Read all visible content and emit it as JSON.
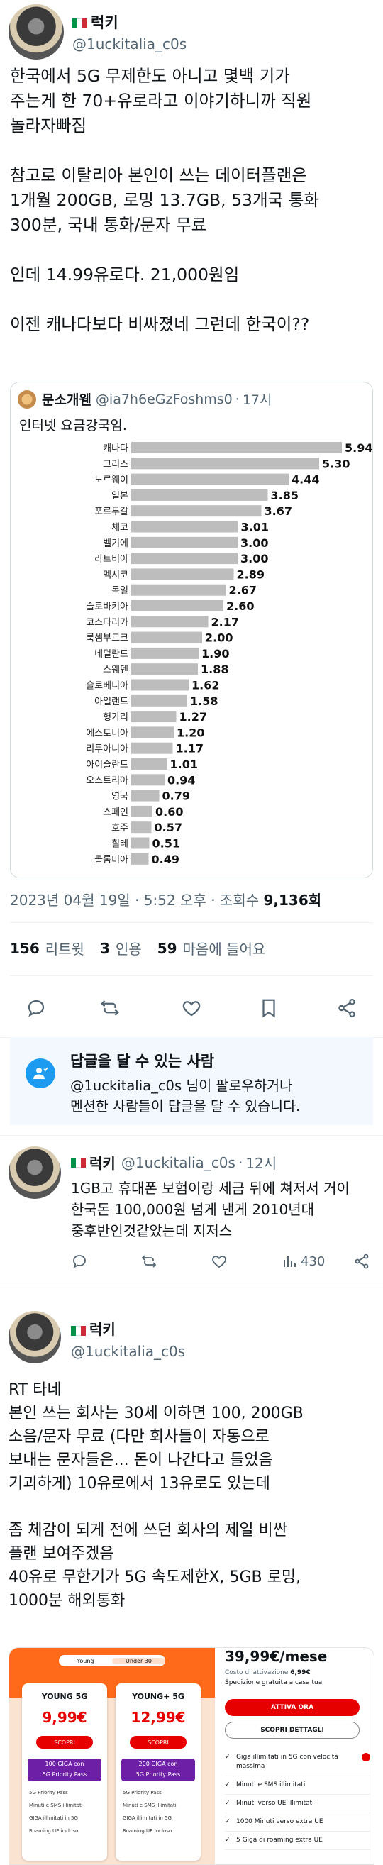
{
  "tweet": {
    "author_name": "럭키",
    "author_handle": "@1uckitalia_c0s",
    "paragraphs": [
      [
        "한국에서 5G 무제한도 아니고 몇백 기가",
        "주는게 한 70+유로라고 이야기하니까 직원",
        "놀라자빠짐"
      ],
      [
        "참고로 이탈리아 본인이 쓰는 데이터플랜은",
        "1개월 200GB, 로밍 13.7GB, 53개국 통화",
        "300분, 국내 통화/문자 무료"
      ],
      [
        "인데 14.99유로다. 21,000원임"
      ],
      [
        "이젠 캐나다보다 비싸졌네 그런데 한국이??"
      ]
    ],
    "quote": {
      "author_name": "문소개웬",
      "author_handle": "@ia7h6eGzFoshms0",
      "time": "17시",
      "text": "인터넷 요금강국임."
    },
    "timestamp": "2023년 04월 19일 · 5:52 오후 · 조회수",
    "views": "9,136회",
    "stats": {
      "retweets_count": "156",
      "retweets_label": "리트윗",
      "quotes_count": "3",
      "quotes_label": "인용",
      "likes_count": "59",
      "likes_label": "마음에 들어요"
    }
  },
  "chart_data": {
    "type": "bar",
    "orientation": "horizontal",
    "categories": [
      "캐나다",
      "그리스",
      "노르웨이",
      "일본",
      "포르투갈",
      "체코",
      "벨기에",
      "라트비아",
      "멕시코",
      "독일",
      "슬로바키아",
      "코스타리카",
      "룩셈부르크",
      "네덜란드",
      "스웨덴",
      "슬로베니아",
      "아일랜드",
      "헝가리",
      "에스토니아",
      "리투아니아",
      "아이슬란드",
      "오스트리아",
      "영국",
      "스페인",
      "호주",
      "칠레",
      "콜롬비아"
    ],
    "values": [
      5.94,
      5.3,
      4.44,
      3.85,
      3.67,
      3.01,
      3.0,
      3.0,
      2.89,
      2.67,
      2.6,
      2.17,
      2.0,
      1.9,
      1.88,
      1.62,
      1.58,
      1.27,
      1.2,
      1.17,
      1.01,
      0.94,
      0.79,
      0.6,
      0.57,
      0.51,
      0.49
    ],
    "value_labels": [
      "5.94",
      "5.30",
      "4.44",
      "3.85",
      "3.67",
      "3.01",
      "3.00",
      "3.00",
      "2.89",
      "2.67",
      "2.60",
      "2.17",
      "2.00",
      "1.90",
      "1.88",
      "1.62",
      "1.58",
      "1.27",
      "1.20",
      "1.17",
      "1.01",
      "0.94",
      "0.79",
      "0.60",
      "0.57",
      "0.51",
      "0.49"
    ],
    "xlim": [
      0,
      6.6
    ],
    "bar_color": "#bdbdbd",
    "grid": false
  },
  "reply_restriction": {
    "title": "답글을 달 수 있는 사람",
    "line1": "@1uckitalia_c0s 님이 팔로우하거나",
    "line2": "멘션한 사람들이 답글을 달 수 있습니다."
  },
  "reply": {
    "author_name": "럭키",
    "author_handle": "@1uckitalia_c0s",
    "time": "12시",
    "lines": [
      "1GB고 휴대폰 보험이랑 세금 뒤에 쳐저서 거이",
      "한국돈 100,000원 넘게 낸게 2010년대",
      "중후반인것같았는데 지저스"
    ],
    "views": "430"
  },
  "thread": {
    "author_name": "럭키",
    "author_handle": "@1uckitalia_c0s",
    "paragraphs": [
      [
        "RT 타네",
        "본인 쓰는 회사는 30세 이하면 100, 200GB",
        "소음/문자 무료 (다만 회사들이 자동으로",
        "보내는 문자들은... 돈이 나간다고 들었음",
        "기괴하게) 10유로에서 13유로도 있는데"
      ],
      [
        "좀 체감이 되게 전에 쓰던 회사의 제일 비싼",
        "플랜 보여주겠음",
        "40유로 무한기가 5G 속도제한X, 5GB 로밍,",
        "1000분 해외통화"
      ]
    ]
  },
  "promo": {
    "tab_left": "Young",
    "tab_right": "Under 30",
    "card1": {
      "name": "YOUNG 5G",
      "price": "9,99€",
      "button": "SCOPRI",
      "badge1": "100 GIGA con",
      "badge2": "5G Priority Pass",
      "features": [
        "5G Priority Pass",
        "Minuti e SMS illimitati",
        "GIGA illimitati in 5G",
        "Roaming UE incluso"
      ]
    },
    "card2": {
      "name": "YOUNG+ 5G",
      "price": "12,99€",
      "button": "SCOPRI",
      "badge1": "200 GIGA con",
      "badge2": "5G Priority Pass",
      "features": [
        "5G Priority Pass",
        "Minuti e SMS illimitati",
        "GIGA illimitati in 5G",
        "Roaming UE incluso"
      ]
    },
    "offer": {
      "price": "39,99€/mese",
      "cost_line": "Costo di attivazione",
      "cost_value": "6,99€",
      "shipping": "Spedizione gratuita a casa tua",
      "primary_button": "ATTIVA ORA",
      "secondary_button": "SCOPRI DETTAGLI",
      "features": [
        "Giga illimitati in 5G con velocità massima",
        "Minuti e SMS illimitati",
        "Minuti verso UE illimitati",
        "1000 Minuti verso extra UE",
        "5 Giga di roaming extra UE"
      ]
    }
  }
}
